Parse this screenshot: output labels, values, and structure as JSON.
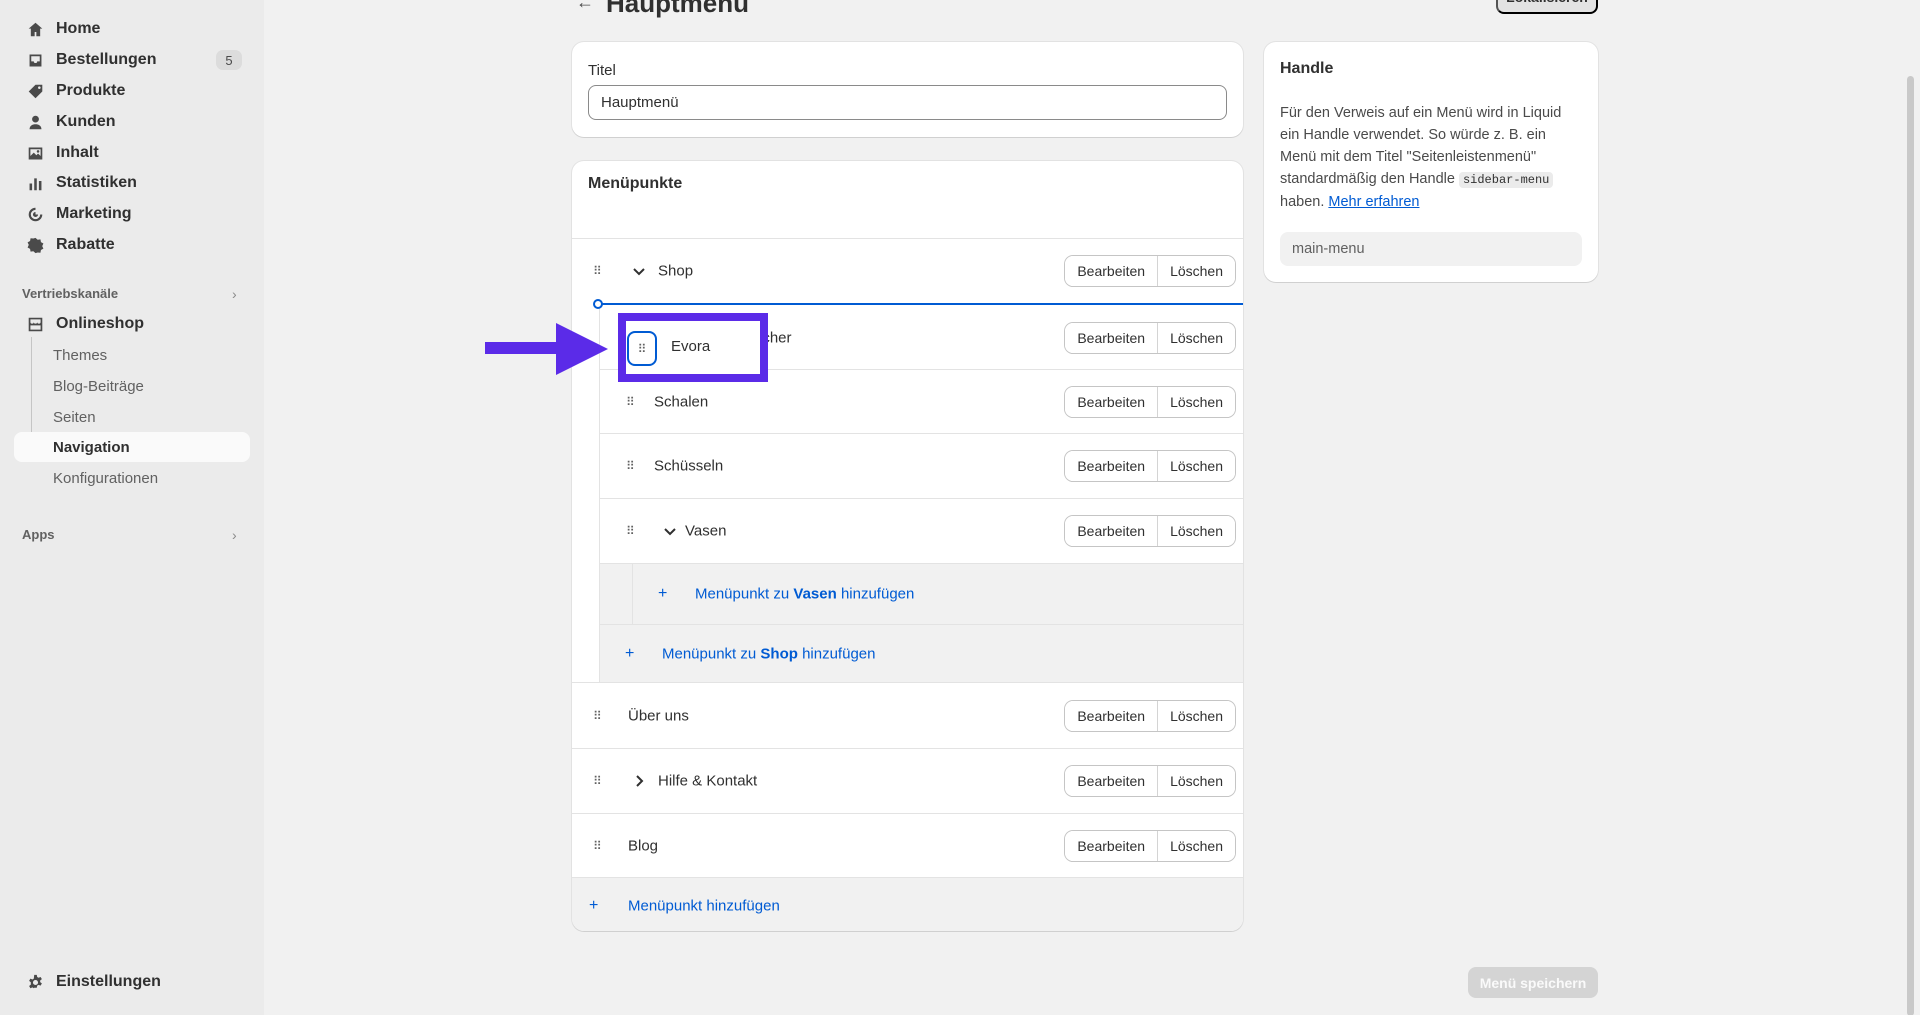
{
  "sidebar": {
    "items": [
      {
        "label": "Home",
        "icon": "home-icon"
      },
      {
        "label": "Bestellungen",
        "icon": "inbox-icon",
        "badge": "5"
      },
      {
        "label": "Produkte",
        "icon": "tag-icon"
      },
      {
        "label": "Kunden",
        "icon": "person-icon"
      },
      {
        "label": "Inhalt",
        "icon": "image-icon"
      },
      {
        "label": "Statistiken",
        "icon": "bar-chart-icon"
      },
      {
        "label": "Marketing",
        "icon": "target-icon"
      },
      {
        "label": "Rabatte",
        "icon": "discount-icon"
      }
    ],
    "sales_channels_label": "Vertriebskanäle",
    "online_store": {
      "label": "Onlineshop",
      "icon": "store-icon"
    },
    "sub_items": [
      "Themes",
      "Blog-Beiträge",
      "Seiten",
      "Navigation",
      "Konfigurationen"
    ],
    "apps_label": "Apps",
    "settings": {
      "label": "Einstellungen",
      "icon": "gear-icon"
    }
  },
  "header": {
    "title": "Hauptmenü",
    "localize_label": "Lokalisieren"
  },
  "title_card": {
    "label": "Titel",
    "value": "Hauptmenü"
  },
  "menu_card": {
    "title": "Menüpunkte",
    "edit_label": "Bearbeiten",
    "delete_label": "Löschen",
    "items": [
      {
        "name": "Shop"
      },
      {
        "name": "echer"
      },
      {
        "name": "Schalen"
      },
      {
        "name": "Schüsseln"
      },
      {
        "name": "Vasen"
      },
      {
        "name": "Über uns"
      },
      {
        "name": "Hilfe & Kontakt"
      },
      {
        "name": "Blog"
      }
    ],
    "add_vasen": {
      "prefix": "Menüpunkt zu ",
      "bold": "Vasen",
      "suffix": " hinzufügen"
    },
    "add_shop": {
      "prefix": "Menüpunkt zu ",
      "bold": "Shop",
      "suffix": " hinzufügen"
    },
    "add_root": "Menüpunkt hinzufügen",
    "dragged_item": "Evora"
  },
  "handle_card": {
    "title": "Handle",
    "text_1": "Für den Verweis auf ein Menü wird in Liquid ein Handle verwendet. So würde z. B. ein Menü mit dem Titel \"Seitenleistenmenü\" standardmäßig den Handle ",
    "code": "sidebar-menu",
    "text_2": " haben. ",
    "link": "Mehr erfahren",
    "handle_value": "main-menu"
  },
  "save_label": "Menü speichern",
  "colors": {
    "accent": "#005bd3",
    "annotation": "#5b2be8"
  }
}
